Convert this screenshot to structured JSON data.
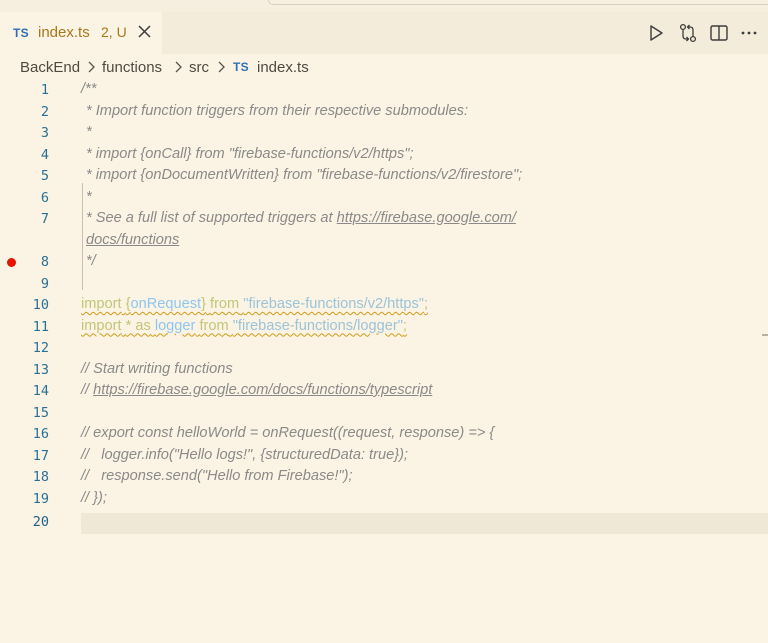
{
  "tab": {
    "lang_badge": "TS",
    "filename": "index.ts",
    "status": "2, U"
  },
  "breadcrumb": {
    "items": [
      "BackEnd",
      "functions",
      "src",
      "index.ts"
    ],
    "file_badge": "TS"
  },
  "actions": [
    "run-icon",
    "compare-changes-icon",
    "split-editor-icon",
    "more-actions-icon"
  ],
  "editor": {
    "line_numbers": [
      "1",
      "2",
      "3",
      "4",
      "5",
      "6",
      "7",
      "8",
      "9",
      "10",
      "11",
      "12",
      "13",
      "14",
      "15",
      "16",
      "17",
      "18",
      "19",
      "20"
    ],
    "lines": {
      "l1": "/**",
      "l2": "* Import function triggers from their respective submodules:",
      "l3": "*",
      "l4": "* import {onCall} from \"firebase-functions/v2/https\";",
      "l5": "* import {onDocumentWritten} from \"firebase-functions/v2/firestore\";",
      "l6": "*",
      "l7a": "* See a full list of supported triggers at ",
      "l7_link": "https://firebase.google.com/",
      "l7_wrap": "docs/functions",
      "l8": "*/",
      "l10": {
        "kw_import": "import",
        "brace_open": "{",
        "ident": "onRequest",
        "brace_close": "}",
        "kw_from": "from",
        "str": "\"firebase-functions/v2/https\"",
        "semi": ";"
      },
      "l11": {
        "kw_import": "import",
        "star_as": "* as",
        "ident": "logger",
        "kw_from": "from",
        "str": "\"firebase-functions/logger\"",
        "semi": ";"
      },
      "l13": "// Start writing functions",
      "l14a": "// ",
      "l14_link": "https://firebase.google.com/docs/functions/typescript",
      "l16": "// export const helloWorld = onRequest((request, response) => {",
      "l17": "//   logger.info(\"Hello logs!\", {structuredData: true});",
      "l18": "//   response.send(\"Hello from Firebase!\");",
      "l19": "// });"
    },
    "breakpoint_line": "8"
  },
  "colors": {
    "background": "#fbf4e4",
    "comment": "#8a8a8a",
    "keyword": "#c5c378",
    "string": "#9cc3d8",
    "line_number": "#2a6f95",
    "breakpoint": "#e51400",
    "tab_modified": "#a7781b"
  }
}
